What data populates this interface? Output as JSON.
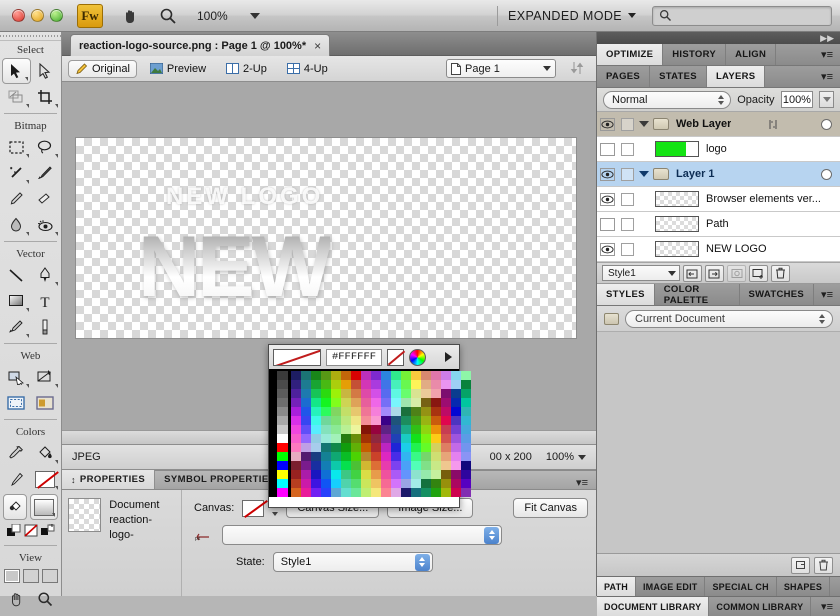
{
  "titlebar": {
    "app_badge": "Fw",
    "hand_icon": "hand-icon",
    "zoom_icon": "magnifier-icon",
    "zoom_level": "100%",
    "mode_label": "EXPANDED MODE",
    "search_placeholder": "",
    "search_value": ""
  },
  "document": {
    "tab_title": "reaction-logo-source.png : Page 1 @ 100%*",
    "close_glyph": "×"
  },
  "viewbar": {
    "tabs": [
      {
        "label": "Original",
        "icon": "pencil-icon",
        "active": true
      },
      {
        "label": "Preview",
        "icon": "image-icon",
        "active": false
      },
      {
        "label": "2-Up",
        "icon": "two-up-icon",
        "active": false
      },
      {
        "label": "4-Up",
        "icon": "four-up-icon",
        "active": false
      }
    ],
    "page_select": "Page 1",
    "sort_icon": "sort-arrows-icon"
  },
  "canvas": {
    "ghost_text": "NEW LOGO",
    "main_text": "NEW"
  },
  "statusbar": {
    "format": "JPEG",
    "dimensions": "00 x 200",
    "zoom": "100%"
  },
  "tools": {
    "groups": [
      {
        "title": "Select",
        "items": [
          "pointer-icon",
          "subselect-icon",
          "scale-icon",
          "crop-icon"
        ]
      },
      {
        "title": "Bitmap",
        "items": [
          "marquee-icon",
          "lasso-icon",
          "magic-wand-icon",
          "brush-icon",
          "pencil-icon",
          "eraser-icon",
          "blur-icon",
          "rubber-stamp-icon"
        ]
      },
      {
        "title": "Vector",
        "items": [
          "line-icon",
          "pen-icon",
          "rectangle-icon",
          "text-icon",
          "freeform-icon",
          "knife-icon"
        ]
      },
      {
        "title": "Web",
        "items": [
          "hotspot-icon",
          "polygon-slice-icon",
          "slice-icon",
          "slice-alt-icon"
        ]
      },
      {
        "title": "Colors",
        "items": [
          "eyedropper-icon",
          "paint-bucket-icon",
          "stroke-color-icon",
          "fill-color-icon"
        ]
      },
      {
        "title": "View",
        "items": [
          "standard-screen-icon",
          "full-screen-menu-icon",
          "full-screen-icon",
          "hand-icon",
          "zoom-icon"
        ]
      }
    ]
  },
  "properties": {
    "tabs": [
      {
        "label": "PROPERTIES",
        "active": true
      },
      {
        "label": "SYMBOL PROPERTIES",
        "active": false
      }
    ],
    "doc_type": "Document",
    "doc_name": "reaction-logo-",
    "canvas_label": "Canvas:",
    "canvas_size_button": "Canvas Size...",
    "image_size_button": "Image Size...",
    "fit_canvas_button": "Fit Canvas",
    "matte_combo": "",
    "state_label": "State:",
    "state_value": "Style1"
  },
  "right_panel": {
    "top_tabs": [
      {
        "label": "OPTIMIZE",
        "active": true
      },
      {
        "label": "HISTORY",
        "active": false
      },
      {
        "label": "ALIGN",
        "active": false
      }
    ],
    "second_tabs": [
      {
        "label": "PAGES",
        "active": false
      },
      {
        "label": "STATES",
        "active": false
      },
      {
        "label": "LAYERS",
        "active": true
      }
    ],
    "blend_mode": "Normal",
    "opacity_label": "Opacity",
    "opacity_value": "100%",
    "layers": [
      {
        "name": "Web Layer",
        "type": "folder",
        "visible": true,
        "locked": false,
        "expanded": true,
        "selected": false,
        "weblayer": true,
        "thumb": "none",
        "share_icon": true
      },
      {
        "name": "logo",
        "type": "object",
        "visible": false,
        "locked": false,
        "selected": false,
        "thumb": "green"
      },
      {
        "name": "Layer 1",
        "type": "folder",
        "visible": true,
        "locked": false,
        "expanded": true,
        "selected": true,
        "thumb": "none"
      },
      {
        "name": "Browser elements ver...",
        "type": "object",
        "visible": true,
        "locked": false,
        "selected": false,
        "thumb": "checker"
      },
      {
        "name": "Path",
        "type": "object",
        "visible": false,
        "locked": false,
        "selected": false,
        "thumb": "checker"
      },
      {
        "name": "NEW LOGO",
        "type": "object",
        "visible": true,
        "locked": false,
        "selected": false,
        "thumb": "checker"
      }
    ],
    "layer_footer": {
      "style_select": "Style1",
      "buttons": [
        "add-mask-icon",
        "add-mask-alt-icon",
        "new-bitmap-icon",
        "new-layer-icon",
        "delete-layer-icon"
      ]
    },
    "styles_tabs": [
      {
        "label": "STYLES",
        "active": true
      },
      {
        "label": "COLOR PALETTE",
        "active": false
      },
      {
        "label": "SWATCHES",
        "active": false
      }
    ],
    "styles_source": "Current Document",
    "styles_footer_buttons": [
      "new-style-icon",
      "delete-style-icon"
    ],
    "bottom_tabs_row1": [
      {
        "label": "PATH",
        "active": true
      },
      {
        "label": "IMAGE EDIT",
        "active": false
      },
      {
        "label": "SPECIAL CH",
        "active": false
      },
      {
        "label": "SHAPES",
        "active": false
      }
    ],
    "bottom_tabs_row2": [
      {
        "label": "DOCUMENT LIBRARY",
        "active": true
      },
      {
        "label": "COMMON LIBRARY",
        "active": false
      }
    ]
  },
  "color_popup": {
    "hex_value": "#FFFFFF",
    "no_color_icon": "no-color-icon",
    "color_wheel_icon": "color-wheel-icon",
    "expand_icon": "expand-arrow-icon"
  },
  "colors": {
    "accent_blue": "#b7d4f0",
    "weblayer_tan": "#c2bcae",
    "logo_green": "#14e414",
    "hex_white": "#FFFFFF"
  }
}
